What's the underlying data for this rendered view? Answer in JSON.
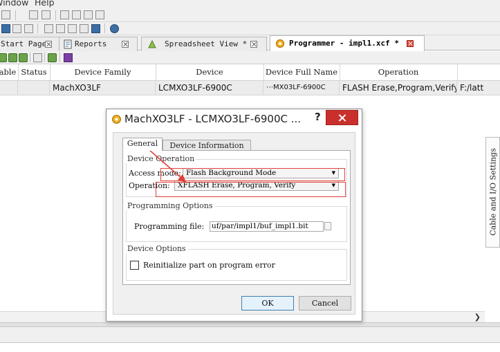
{
  "menu": {
    "window": "Window",
    "help": "Help"
  },
  "colors": {
    "accent_red": "#c9302c",
    "annotation_red": "#e0403a",
    "tab_active_bg": "#ffffff"
  },
  "tabs": [
    {
      "label": "Start Page",
      "icon": "none",
      "active": false
    },
    {
      "label": "Reports",
      "icon": "report-icon",
      "active": false
    },
    {
      "label": "Spreadsheet View *",
      "icon": "spreadsheet-icon",
      "active": false
    },
    {
      "label": "Programmer - impl1.xcf *",
      "icon": "programmer-icon",
      "active": true
    }
  ],
  "table": {
    "headers": [
      "able",
      "Status",
      "Device Family",
      "Device",
      "Device Full Name",
      "Operation"
    ],
    "rows": [
      {
        "status": "",
        "family": "MachXO3LF",
        "device": "LCMXO3LF-6900C",
        "full_name": "⋯MX03LF-6900C",
        "operation": "FLASH Erase,Program,Verify",
        "file": "F:/latt"
      }
    ]
  },
  "side_panel": {
    "label": "Cable and I/O Settings"
  },
  "dialog": {
    "title": "MachXO3LF - LCMXO3LF-6900C ...",
    "help": "?",
    "tabs": {
      "general": "General",
      "device_info": "Device Information"
    },
    "device_operation": {
      "title": "Device Operation",
      "access_label": "Access mode:",
      "access_value": "Flash Background Mode",
      "operation_label": "Operation:",
      "operation_value": "XFLASH Erase, Program, Verify"
    },
    "programming_options": {
      "title": "Programming Options",
      "file_label": "Programming file:",
      "file_value": "uf/par/impl1/buf_impl1.bit"
    },
    "device_options": {
      "title": "Device Options",
      "reinit_label": "Reinitialize part on program error",
      "reinit_checked": false
    },
    "buttons": {
      "ok": "OK",
      "cancel": "Cancel"
    }
  }
}
